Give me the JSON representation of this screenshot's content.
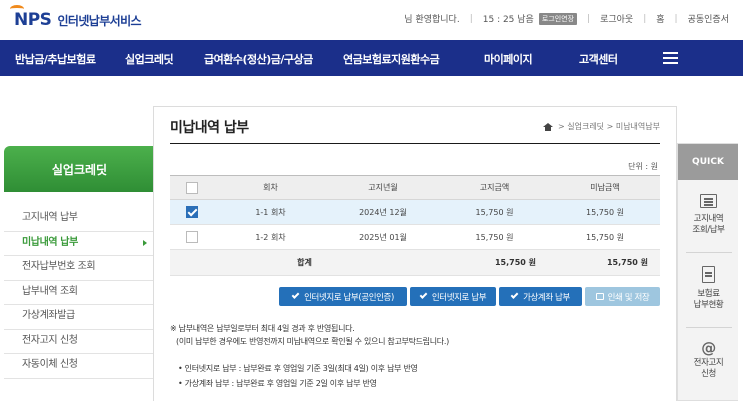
{
  "header": {
    "logo_mark": "NPS",
    "logo_name": "인터넷납부서비스",
    "greeting": "님 환영합니다.",
    "timer": "15 : 25 남음",
    "extend_label": "로그인연장",
    "logout": "로그아웃",
    "home": "홈",
    "certificate": "공동인증서"
  },
  "nav": {
    "items": [
      "반납금/추납보험료",
      "실업크레딧",
      "급여환수(정산)금/구상금",
      "연금보험료지원환수금",
      "마이페이지",
      "고객센터"
    ]
  },
  "sidebar": {
    "title": "실업크레딧",
    "items": [
      {
        "label": "고지내역 납부"
      },
      {
        "label": "미납내역 납부"
      },
      {
        "label": "전자납부번호 조회"
      },
      {
        "label": "납부내역 조회"
      },
      {
        "label": "가상계좌발급"
      },
      {
        "label": "전자고지 신청"
      },
      {
        "label": "자동이체 신청"
      }
    ]
  },
  "main": {
    "title": "미납내역 납부",
    "breadcrumb": "> 실업크레딧 > 미납내역납부",
    "unit": "단위 : 원",
    "columns": [
      "회차",
      "고지년월",
      "고지금액",
      "미납금액"
    ],
    "rows": [
      {
        "round": "1-1 회차",
        "month": "2024년 12월",
        "billed": "15,750 원",
        "unpaid": "15,750 원",
        "checked": true
      },
      {
        "round": "1-2 회차",
        "month": "2025년 01월",
        "billed": "15,750 원",
        "unpaid": "15,750 원",
        "checked": false
      }
    ],
    "total": {
      "label": "합계",
      "billed": "15,750 원",
      "unpaid": "15,750 원"
    },
    "buttons": {
      "pay_cert": "인터넷지로 납부(공인인증)",
      "pay_giro": "인터넷지로 납부",
      "pay_virtual": "가상계좌 납부",
      "print": "인쇄 및 저장"
    },
    "notes": [
      "※ 납부내역은 납부일로부터 최대 4일 경과 후 반영됩니다.",
      "(이미 납부한 경우에도 반영전까지 미납내역으로 확인될 수 있으니 참고부탁드립니다.)"
    ],
    "bullets": [
      "• 인터넷지로 납부 : 납부완료 후 영업일 기준 3일(최대 4일) 이후 납부 반영",
      "• 가상계좌 납부 : 납부완료 후 영업일 기준 2일 이후 납부 반영"
    ]
  },
  "quick": {
    "title": "QUICK",
    "items": [
      "고지내역\n조회/납부",
      "보험료\n납부현황",
      "전자고지\n신청"
    ]
  },
  "colors": {
    "nav": "#1b2f8a",
    "sidebar_head": "#3a9a3a",
    "button": "#2470b9",
    "selected_row": "#e5f2fb"
  }
}
